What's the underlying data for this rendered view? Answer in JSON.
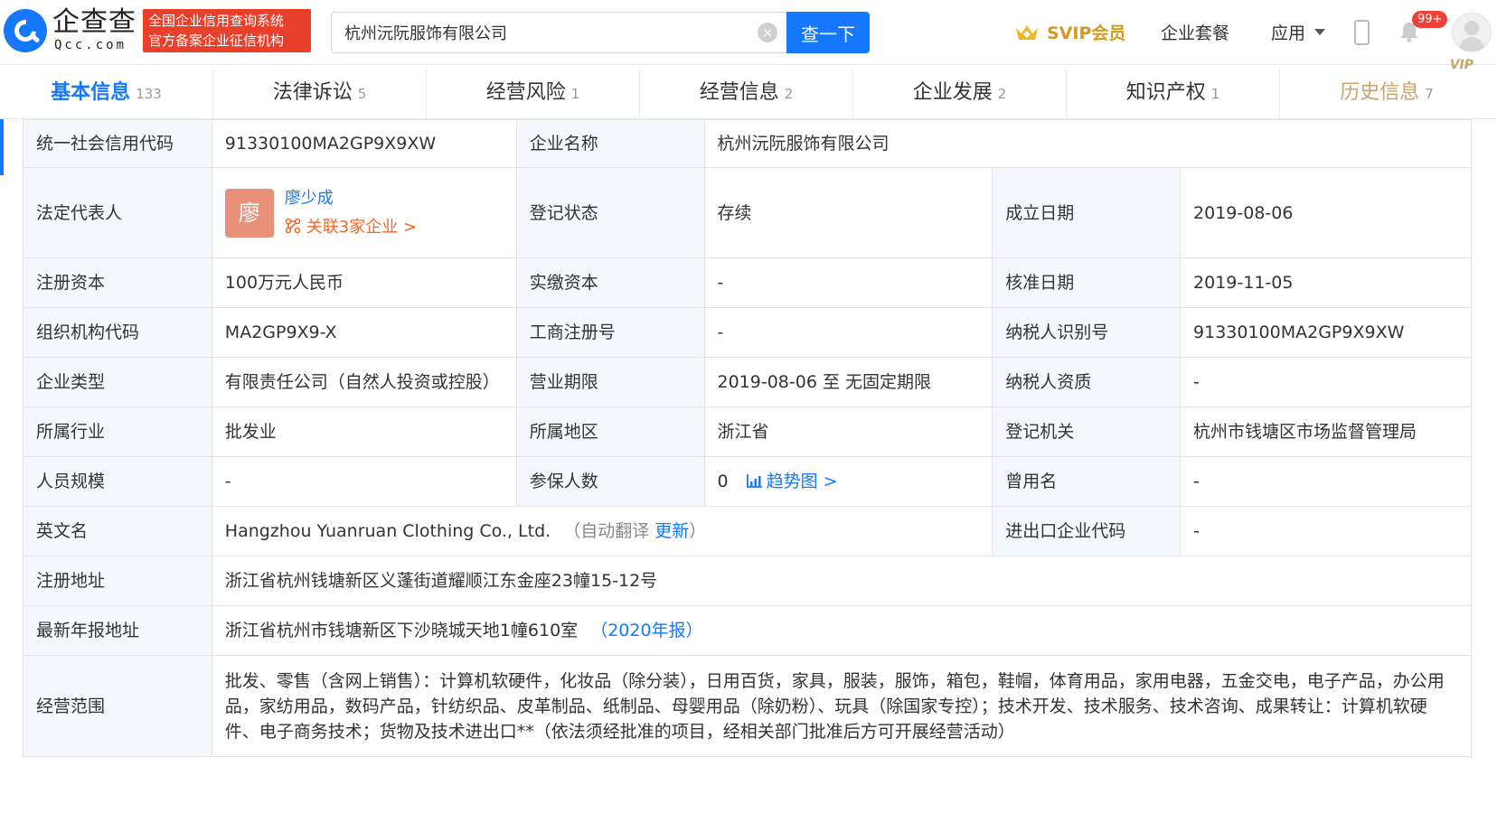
{
  "header": {
    "logo_name": "企查查",
    "logo_sub": "Qcc.com",
    "cert_line1": "全国企业信用查询系统",
    "cert_line2": "官方备案企业征信机构",
    "search_value": "杭州沅阮服饰有限公司",
    "search_button": "查一下",
    "svip_label": "SVIP会员",
    "package_label": "企业套餐",
    "apps_label": "应用",
    "notification_count": "99+"
  },
  "tabs": [
    {
      "label": "基本信息",
      "count": "133"
    },
    {
      "label": "法律诉讼",
      "count": "5"
    },
    {
      "label": "经营风险",
      "count": "1"
    },
    {
      "label": "经营信息",
      "count": "2"
    },
    {
      "label": "企业发展",
      "count": "2"
    },
    {
      "label": "知识产权",
      "count": "1"
    },
    {
      "label": "历史信息",
      "count": "7",
      "tag": "VIP"
    }
  ],
  "info": {
    "credit_code_label": "统一社会信用代码",
    "credit_code": "91330100MA2GP9X9XW",
    "company_name_label": "企业名称",
    "company_name": "杭州沅阮服饰有限公司",
    "legal_rep_label": "法定代表人",
    "legal_rep_avatar": "廖",
    "legal_rep_name": "廖少成",
    "legal_rep_related": "关联3家企业 >",
    "reg_status_label": "登记状态",
    "reg_status": "存续",
    "founded_label": "成立日期",
    "founded": "2019-08-06",
    "reg_capital_label": "注册资本",
    "reg_capital": "100万元人民币",
    "paid_capital_label": "实缴资本",
    "paid_capital": "-",
    "approved_label": "核准日期",
    "approved": "2019-11-05",
    "org_code_label": "组织机构代码",
    "org_code": "MA2GP9X9-X",
    "biz_reg_no_label": "工商注册号",
    "biz_reg_no": "-",
    "taxpayer_id_label": "纳税人识别号",
    "taxpayer_id": "91330100MA2GP9X9XW",
    "company_type_label": "企业类型",
    "company_type": "有限责任公司（自然人投资或控股）",
    "term_label": "营业期限",
    "term": "2019-08-06 至 无固定期限",
    "taxpayer_qual_label": "纳税人资质",
    "taxpayer_qual": "-",
    "industry_label": "所属行业",
    "industry": "批发业",
    "region_label": "所属地区",
    "region": "浙江省",
    "authority_label": "登记机关",
    "authority": "杭州市钱塘区市场监督管理局",
    "staff_label": "人员规模",
    "staff": "-",
    "insured_label": "参保人数",
    "insured": "0",
    "trend_link": "趋势图 >",
    "former_name_label": "曾用名",
    "former_name": "-",
    "english_label": "英文名",
    "english_name": "Hangzhou Yuanruan Clothing Co., Ltd.",
    "auto_translate_prefix": "（自动翻译",
    "update_link": "更新",
    "auto_translate_suffix": "）",
    "import_export_label": "进出口企业代码",
    "import_export": "-",
    "reg_address_label": "注册地址",
    "reg_address": "浙江省杭州钱塘新区义蓬街道耀顺江东金座23幢15-12号",
    "annual_address_label": "最新年报地址",
    "annual_address": "浙江省杭州市钱塘新区下沙晓城天地1幢610室",
    "annual_report_link": "（2020年报）",
    "scope_label": "经营范围",
    "scope": "批发、零售（含网上销售）：计算机软硬件，化妆品（除分装），日用百货，家具，服装，服饰，箱包，鞋帽，体育用品，家用电器，五金交电，电子产品，办公用品，家纺用品，数码产品，针纺织品、皮革制品、纸制品、母婴用品（除奶粉）、玩具（除国家专控）；技术开发、技术服务、技术咨询、成果转让：计算机软硬件、电子商务技术；货物及技术进出口**（依法须经批准的项目，经相关部门批准后方可开展经营活动）"
  }
}
